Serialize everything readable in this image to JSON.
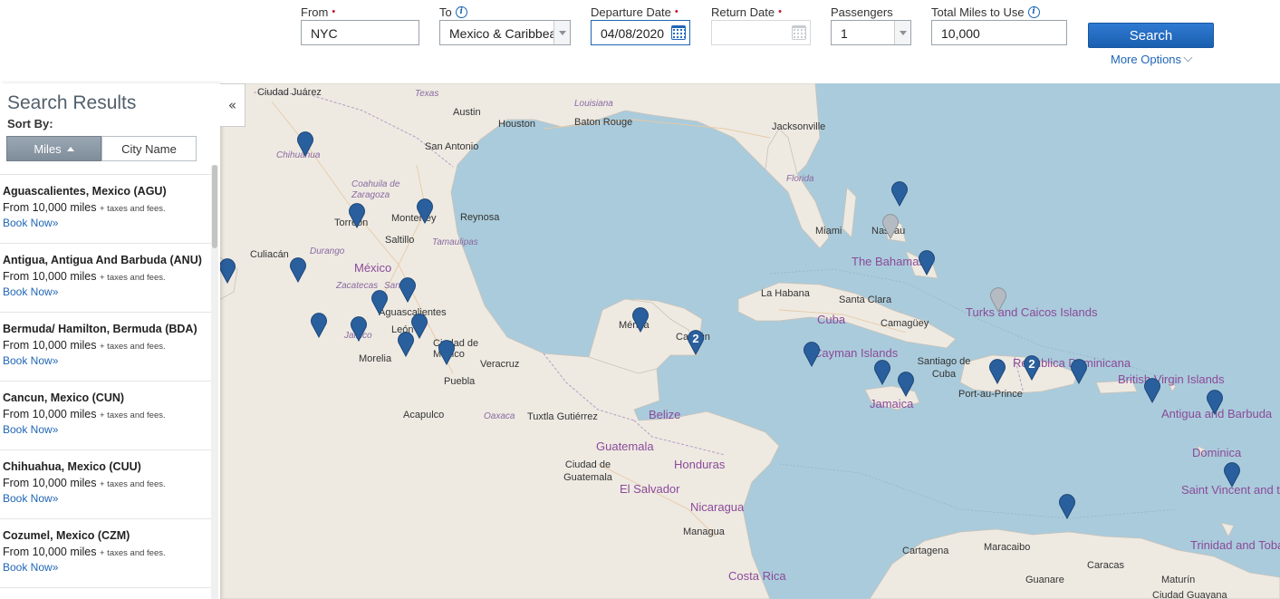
{
  "search": {
    "from": {
      "label": "From",
      "value": "NYC"
    },
    "to": {
      "label": "To",
      "value": "Mexico & Caribbean"
    },
    "departure": {
      "label": "Departure Date",
      "value": "04/08/2020"
    },
    "return": {
      "label": "Return Date",
      "value": ""
    },
    "passengers": {
      "label": "Passengers",
      "value": "1"
    },
    "miles": {
      "label": "Total Miles to Use",
      "value": "10,000"
    },
    "search_label": "Search",
    "more_options_label": "More Options",
    "required_mark": "•",
    "info_glyph": "i"
  },
  "sidebar": {
    "title": "Search Results",
    "sort_by": "Sort By:",
    "sort_miles": "Miles",
    "sort_city": "City Name",
    "collapse_glyph": "«",
    "results": [
      {
        "name": "Aguascalientes, Mexico (AGU)",
        "miles": "From 10,000 miles",
        "fees": "+ taxes and fees.",
        "book": "Book Now»"
      },
      {
        "name": "Antigua, Antigua And Barbuda (ANU)",
        "miles": "From 10,000 miles",
        "fees": "+ taxes and fees.",
        "book": "Book Now»"
      },
      {
        "name": "Bermuda/ Hamilton, Bermuda (BDA)",
        "miles": "From 10,000 miles",
        "fees": "+ taxes and fees.",
        "book": "Book Now»"
      },
      {
        "name": "Cancun, Mexico (CUN)",
        "miles": "From 10,000 miles",
        "fees": "+ taxes and fees.",
        "book": "Book Now»"
      },
      {
        "name": "Chihuahua, Mexico (CUU)",
        "miles": "From 10,000 miles",
        "fees": "+ taxes and fees.",
        "book": "Book Now»"
      },
      {
        "name": "Cozumel, Mexico (CZM)",
        "miles": "From 10,000 miles",
        "fees": "+ taxes and fees.",
        "book": "Book Now»"
      }
    ]
  },
  "map": {
    "cities": [
      "Ciudad Juárez",
      "Austin",
      "Houston",
      "Baton Rouge",
      "Jacksonville",
      "San Antonio",
      "Chihuahua",
      "Torreón",
      "Monterrey",
      "Reynosa",
      "Saltillo",
      "Culiacán",
      "Miami",
      "Nassau",
      "La Habana",
      "Santa Clara",
      "Camagüey",
      "Aguascalientes",
      "León",
      "Morelia",
      "Ciudad de México",
      "Veracruz",
      "Puebla",
      "Mérida",
      "Cancún",
      "Santiago de Cuba",
      "Port-au-Prince",
      "Acapulco",
      "Tuxtla Gutiérrez",
      "Ciudad de Guatemala",
      "Managua",
      "Cartagena",
      "Maracaibo",
      "Caracas",
      "Guanare",
      "Maturín",
      "Ciudad Guayana"
    ],
    "states": [
      "Texas",
      "Louisiana",
      "Florida",
      "Coahuila de Zaragoza",
      "Durango",
      "Tamaulipas",
      "Zacatecas",
      "San Luis Potosí",
      "Jalisco",
      "Oaxaca"
    ],
    "countries": [
      "México",
      "Cuba",
      "The Bahamas",
      "Turks and Caicos Islands",
      "Cayman Islands",
      "Jamaica",
      "República Dominicana",
      "British Virgin Islands",
      "Antigua and Barbuda",
      "Dominica",
      "Saint Vincent and the Grenadines",
      "Belize",
      "Guatemala",
      "Honduras",
      "El Salvador",
      "Nicaragua",
      "Costa Rica",
      "Trinidad and Tobago"
    ],
    "clusters": [
      "2",
      "2"
    ],
    "colors": {
      "water": "#aacbdb",
      "land": "#eeeae2",
      "pin": "#2a5f9e",
      "pin_inactive": "#b4bbc2"
    }
  }
}
